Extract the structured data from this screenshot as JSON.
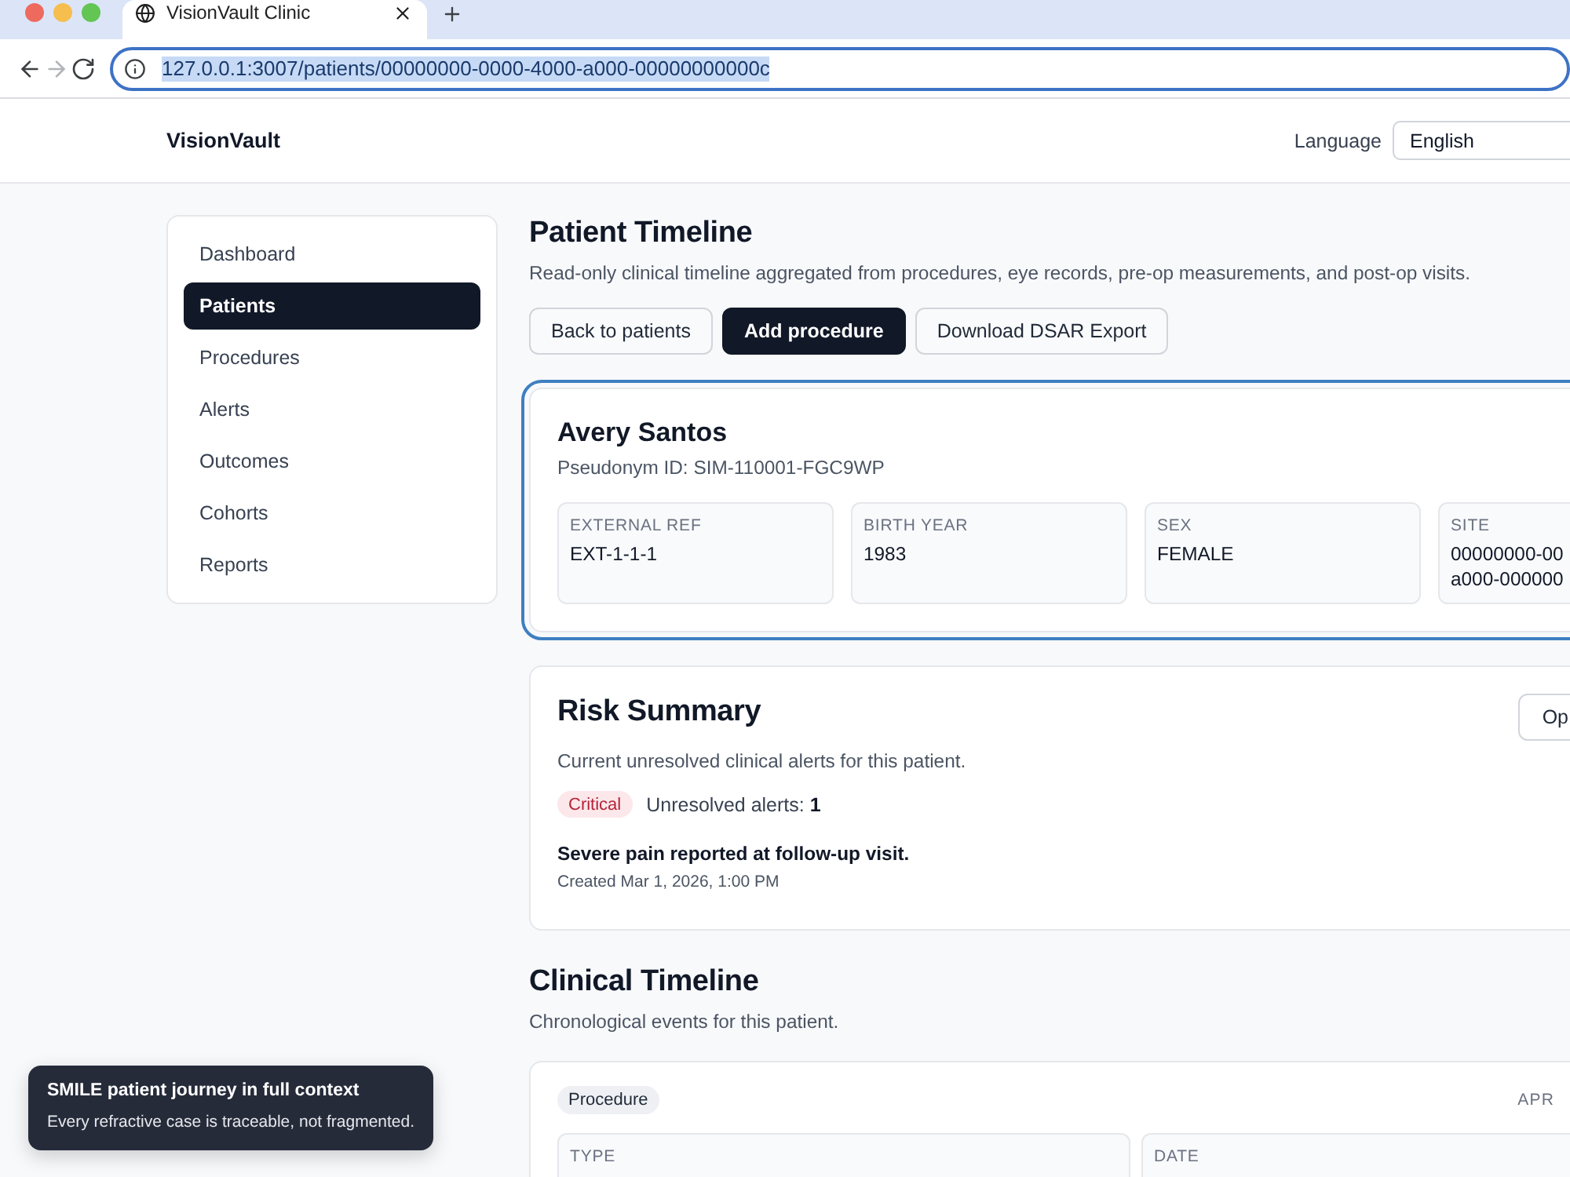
{
  "browser": {
    "tabs": [
      {
        "title": "VisionVault Clinic",
        "selected": true
      }
    ],
    "nav": [
      {
        "kind": "back",
        "disabled": false
      },
      {
        "kind": "forward",
        "disabled": true
      },
      {
        "kind": "reload",
        "disabled": false
      }
    ],
    "address_bar": {
      "url": "127.0.0.1:3007/patients/00000000-0000-4000-a000-00000000000c",
      "focused": true,
      "text_selected": true
    }
  },
  "header": {
    "brand": "VisionVault",
    "language_label": "Language",
    "language_value": "English"
  },
  "sidebar": {
    "items": [
      {
        "label": "Dashboard",
        "selected": false
      },
      {
        "label": "Patients",
        "selected": true
      },
      {
        "label": "Procedures",
        "selected": false
      },
      {
        "label": "Alerts",
        "selected": false
      },
      {
        "label": "Outcomes",
        "selected": false
      },
      {
        "label": "Cohorts",
        "selected": false
      },
      {
        "label": "Reports",
        "selected": false
      }
    ]
  },
  "page": {
    "title": "Patient Timeline",
    "subtitle": "Read-only clinical timeline aggregated from procedures, eye records, pre-op measurements, and post-op visits.",
    "actions": [
      {
        "label": "Back to patients",
        "kind": "secondary"
      },
      {
        "label": "Add procedure",
        "kind": "primary"
      },
      {
        "label": "Download DSAR Export",
        "kind": "secondary"
      }
    ]
  },
  "patient_card": {
    "focused": true,
    "name": "Avery Santos",
    "pseudonym": "Pseudonym ID: SIM-110001-FGC9WP",
    "fields": [
      {
        "label": "EXTERNAL REF",
        "value": "EXT-1-1-1"
      },
      {
        "label": "BIRTH YEAR",
        "value": "1983"
      },
      {
        "label": "SEX",
        "value": "FEMALE"
      },
      {
        "label": "SITE",
        "value": "00000000-00\na000-000000"
      }
    ]
  },
  "risk_summary": {
    "title": "Risk Summary",
    "subtitle": "Current unresolved clinical alerts for this patient.",
    "button": "Op",
    "severity": {
      "label": "Critical",
      "kind": "critical"
    },
    "count_text": "Unresolved alerts: **1**",
    "alerts": [
      {
        "message": "Severe pain reported at follow-up visit.",
        "created": "Created Mar 1, 2026, 1:00 PM"
      }
    ]
  },
  "clinical_timeline": {
    "title": "Clinical Timeline",
    "subtitle": "Chronological events for this patient.",
    "events": [
      {
        "type_label": "Procedure",
        "date": "APR",
        "fields": [
          {
            "label": "TYPE"
          },
          {
            "label": "DATE"
          }
        ]
      }
    ]
  },
  "toast": {
    "title": "SMILE patient journey in full context",
    "message": "Every refractive case is traceable, not fragmented."
  }
}
